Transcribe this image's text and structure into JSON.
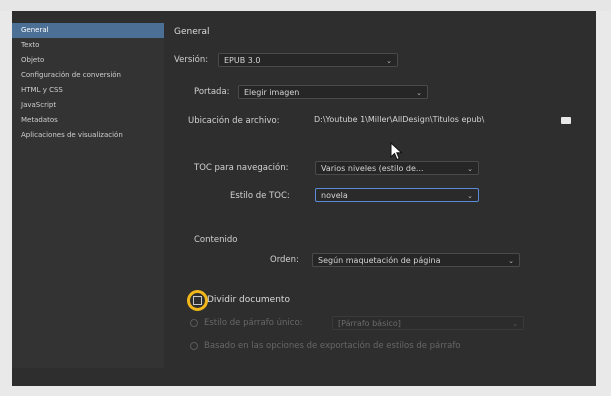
{
  "sidebar": {
    "items": [
      {
        "label": "General",
        "active": true
      },
      {
        "label": "Texto"
      },
      {
        "label": "Objeto"
      },
      {
        "label": "Configuración de conversión"
      },
      {
        "label": "HTML y CSS"
      },
      {
        "label": "JavaScript"
      },
      {
        "label": "Metadatos"
      },
      {
        "label": "Aplicaciones de visualización"
      }
    ]
  },
  "general": {
    "title": "General",
    "version_label": "Versión:",
    "version_value": "EPUB 3.0",
    "cover_label": "Portada:",
    "cover_value": "Elegir imagen",
    "location_label": "Ubicación de archivo:",
    "location_value": "D:\\Youtube 1\\Miller\\AllDesign\\Titulos epub\\",
    "toc_nav_label": "TOC para navegación:",
    "toc_nav_value": "Varios niveles (estilo de...",
    "toc_style_label": "Estilo de TOC:",
    "toc_style_value": "novela",
    "content_label": "Contenido",
    "order_label": "Orden:",
    "order_value": "Según maquetación de página",
    "split_label": "Dividir documento",
    "split_checked": false,
    "single_style_label": "Estilo de párrafo único:",
    "single_style_value": "[Párrafo básico]",
    "paragraph_style_label": "Basado en las opciones de exportación de estilos de párrafo"
  },
  "colors": {
    "accent_selected": "#4c6f96",
    "focus_ring": "#5b8bd6",
    "highlight_circle": "#f2b81b"
  }
}
